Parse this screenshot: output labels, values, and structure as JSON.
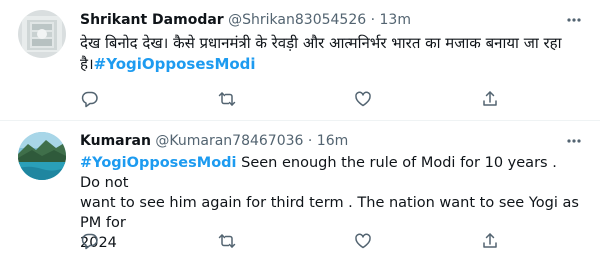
{
  "tweets": [
    {
      "name": "Shrikant Damodar",
      "handle": "@Shrikan83054526",
      "separator": "·",
      "time": "13m",
      "text_line1": "देख बिनोद देख। कैसे प्रधानमंत्री के रेवड़ी और आत्मनिर्भर भारत का मजाक बनाया जा रहा",
      "text_pre_hashtag": "है।",
      "hashtag": "#YogiOpposesModi",
      "text_post_hashtag": ""
    },
    {
      "name": "Kumaran",
      "handle": "@Kumaran78467036",
      "separator": "·",
      "time": "16m",
      "text_line1_post_hashtag": " Seen enough the rule of Modi for 10 years . Do not",
      "hashtag": "#YogiOpposesModi",
      "text_line2": "want to see him again for third term . The nation want to see Yogi as PM for",
      "text_line3": "2024"
    }
  ],
  "colors": {
    "text": "#0f1419",
    "secondary": "#536471",
    "link": "#1d9bf0",
    "divider": "#eff3f4"
  },
  "icons": [
    "more-icon",
    "reply-icon",
    "retweet-icon",
    "like-icon",
    "share-icon"
  ]
}
